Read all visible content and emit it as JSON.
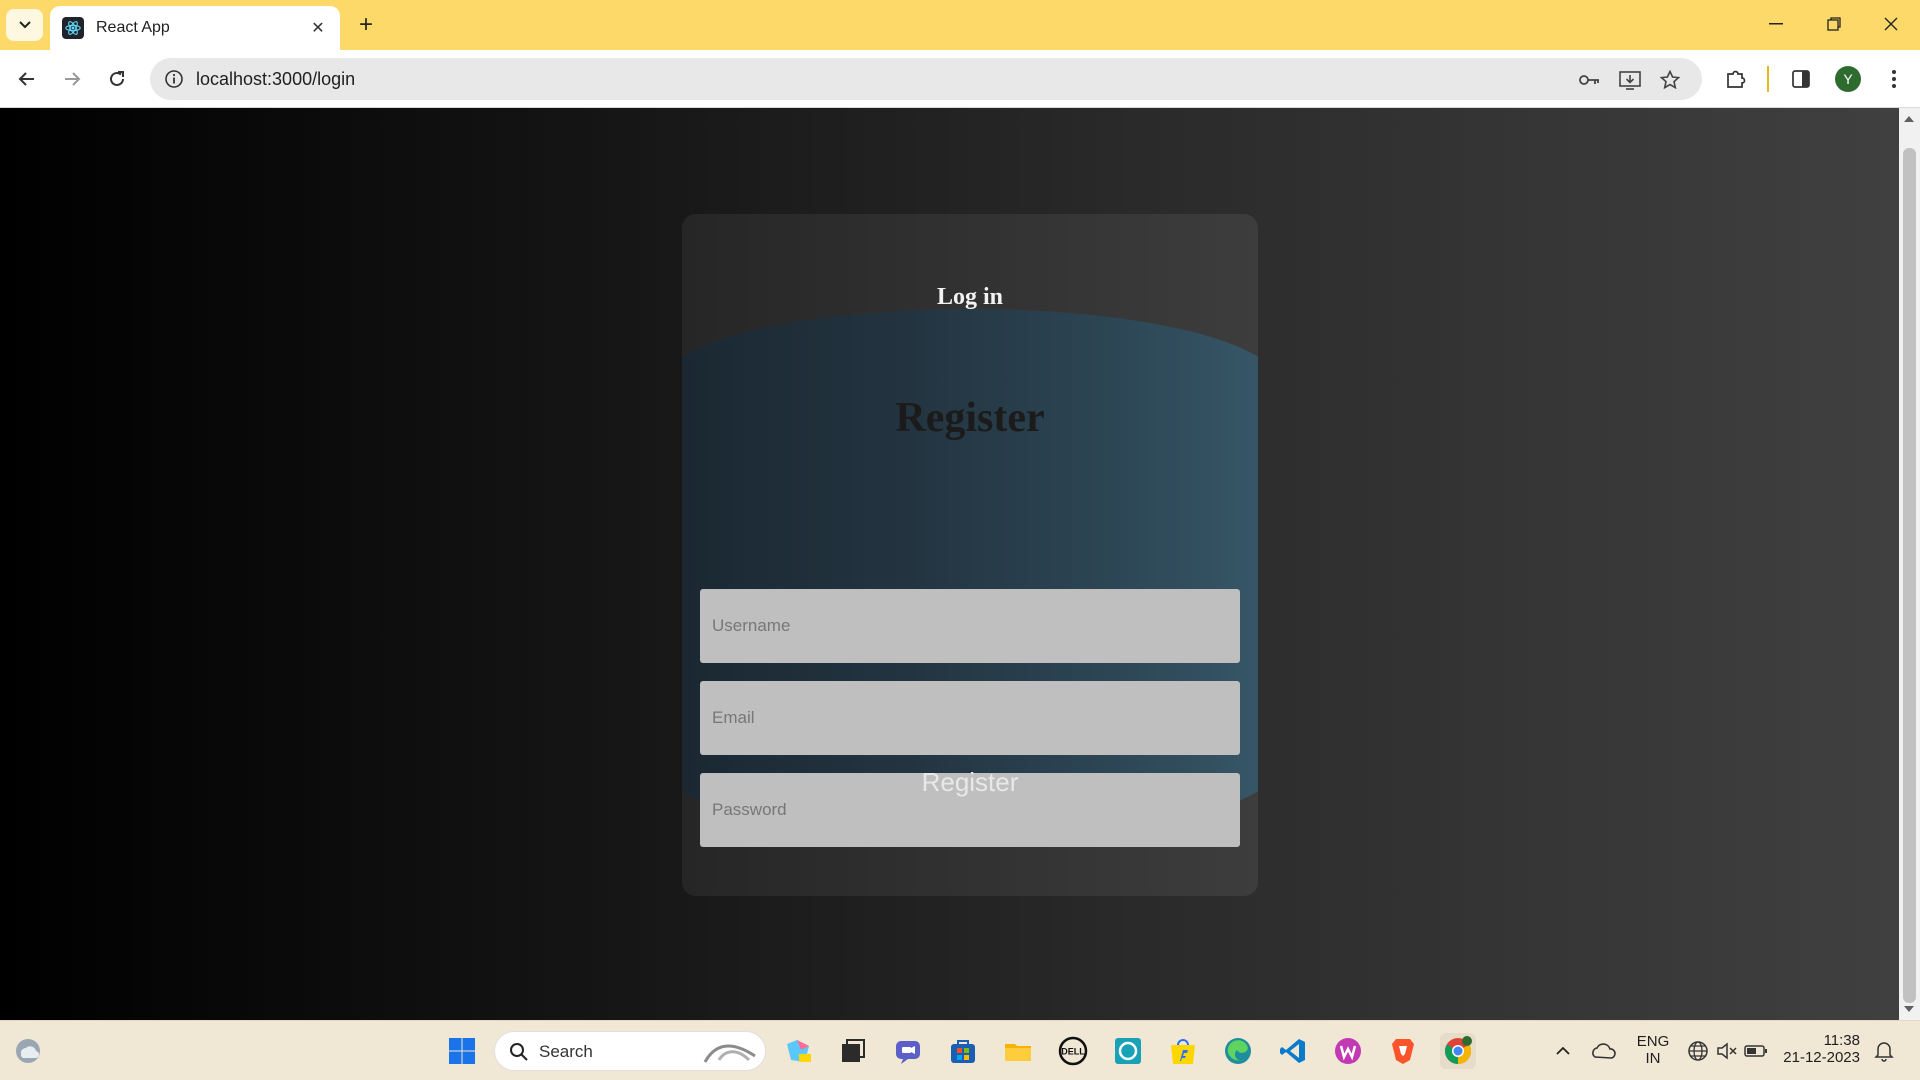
{
  "browser": {
    "tab_title": "React App",
    "url": "localhost:3000/login",
    "avatar_letter": "Y"
  },
  "page": {
    "login_link": "Log in",
    "register_title": "Register",
    "username_placeholder": "Username",
    "email_placeholder": "Email",
    "password_placeholder": "Password",
    "register_button": "Register"
  },
  "taskbar": {
    "search_label": "Search",
    "language_top": "ENG",
    "language_bottom": "IN",
    "time": "11:38",
    "date": "21-12-2023"
  },
  "colors": {
    "tabbar": "#fdd96a",
    "panel_gradient_start": "#1a2731",
    "panel_gradient_end": "#385869",
    "input_background": "#bfbfbf"
  }
}
